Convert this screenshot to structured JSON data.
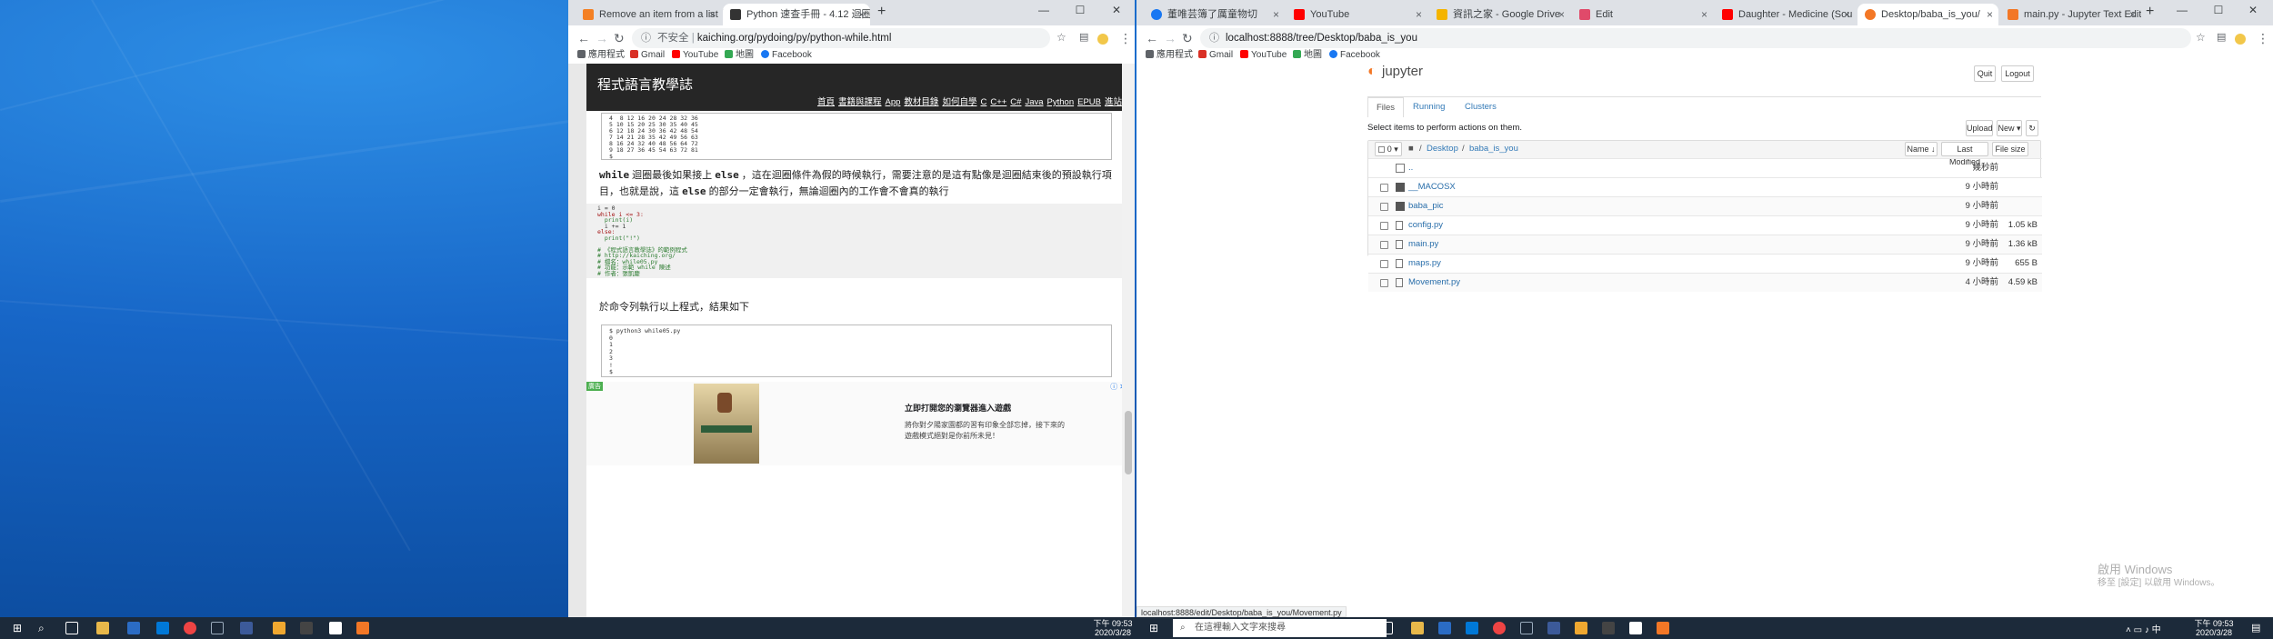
{
  "left_browser": {
    "tabs": [
      {
        "title": "Remove an item from a list in P",
        "close": "×"
      },
      {
        "title": "Python 速查手冊 - 4.12 迴圈敘述 w",
        "close": "×"
      }
    ],
    "new_tab": "+",
    "controls": {
      "min": "—",
      "max": "☐",
      "close": "✕"
    },
    "nav": {
      "back": "←",
      "forward": "→",
      "reload": "↻"
    },
    "address": {
      "security": "不安全",
      "url": "kaiching.org/pydoing/py/python-while.html"
    },
    "bookmarks": [
      "應用程式",
      "Gmail",
      "YouTube",
      "地圖",
      "Facebook"
    ],
    "site": {
      "title": "程式語言教學誌",
      "nav": [
        "首頁",
        "書籍與課程",
        "App",
        "教材目錄",
        "如何自學",
        "C",
        "C++",
        "C#",
        "Java",
        "Python",
        "EPUB",
        "進站"
      ]
    },
    "table_lines": [
      "4  8 12 16 20 24 28 32 36",
      "5 10 15 20 25 30 35 40 45",
      "6 12 18 24 30 36 42 48 54",
      "7 14 21 28 35 42 49 56 63",
      "8 16 24 32 40 48 56 64 72",
      "9 18 27 36 45 54 63 72 81",
      "$"
    ],
    "paragraph1": {
      "kw1": "while",
      "text1": " 迴圈最後如果接上 ",
      "kw2": "else",
      "text2": " ，這在迴圈條件為假的時候執行，需要注意的是這有點像是迴圈結束後的預設執行項目，也就是說，這 ",
      "kw3": "else",
      "text3": " 的部分一定會執行，無論迴圈內的工作會不會真的執行"
    },
    "code_lines": [
      {
        "t": "i = 0",
        "c": "#333"
      },
      {
        "t": "while i <= 3:",
        "c": "#a31515"
      },
      {
        "t": "  print(i)",
        "c": "#2e7d32"
      },
      {
        "t": "  i += 1",
        "c": "#333"
      },
      {
        "t": "else:",
        "c": "#a31515"
      },
      {
        "t": "  print(\"!\")",
        "c": "#2e7d32"
      },
      {
        "t": "",
        "c": "#333"
      },
      {
        "t": "# 《程式語言教學誌》的範例程式",
        "c": "#2e7d32"
      },
      {
        "t": "# http://kaiching.org/",
        "c": "#2e7d32"
      },
      {
        "t": "# 檔名：while05.py",
        "c": "#2e7d32"
      },
      {
        "t": "# 功能：示範 while 陳述",
        "c": "#2e7d32"
      },
      {
        "t": "# 作者：張凱慶",
        "c": "#2e7d32"
      }
    ],
    "paragraph2": "於命令列執行以上程式，結果如下",
    "output_lines": [
      "$ python3 while05.py",
      "0",
      "1",
      "2",
      "3",
      "!",
      "$"
    ],
    "ad": {
      "badge": "廣告",
      "headline": "立即打開您的瀏覽器進入遊戲",
      "body1": "將你對夕陽家園都的習有印象全部忘掉，接下來的",
      "body2": "遊戲模式絕對是你前所未見！",
      "close": "ⓘ ✕"
    }
  },
  "right_browser": {
    "tabs": [
      {
        "title": "董唯芸簿了厲童物切",
        "close": "×"
      },
      {
        "title": "YouTube",
        "close": "×"
      },
      {
        "title": "資訊之家 - Google Drive",
        "close": "×"
      },
      {
        "title": "Edit",
        "close": "×"
      },
      {
        "title": "Daughter - Medicine (Sou",
        "close": "×"
      },
      {
        "title": "Desktop/baba_is_you/",
        "close": "×"
      },
      {
        "title": "main.py - Jupyter Text Editor",
        "close": "×"
      }
    ],
    "new_tab": "+",
    "controls": {
      "min": "—",
      "max": "☐",
      "close": "✕"
    },
    "nav": {
      "back": "←",
      "forward": "→",
      "reload": "↻"
    },
    "address": {
      "url": "localhost:8888/tree/Desktop/baba_is_you"
    },
    "bookmarks": [
      "應用程式",
      "Gmail",
      "YouTube",
      "地圖",
      "Facebook"
    ],
    "status_url": "localhost:8888/edit/Desktop/baba_is_you/Movement.py",
    "jupyter": {
      "logo": "jupyter",
      "quit": "Quit",
      "logout": "Logout",
      "tabs": [
        "Files",
        "Running",
        "Clusters"
      ],
      "hint": "Select items to perform actions on them.",
      "upload": "Upload",
      "new": "New ▾",
      "refresh": "↻",
      "select_count": "0",
      "breadcrumb": [
        "Desktop",
        "baba_is_you"
      ],
      "sort_name": "Name ↓",
      "sort_modified": "Last Modified",
      "sort_size": "File size",
      "parent_row": {
        "name": "..",
        "time": "幾秒前"
      },
      "rows": [
        {
          "name": "__MACOSX",
          "kind": "folder",
          "time": "9 小時前",
          "size": ""
        },
        {
          "name": "baba_pic",
          "kind": "folder",
          "time": "9 小時前",
          "size": ""
        },
        {
          "name": "config.py",
          "kind": "file",
          "time": "9 小時前",
          "size": "1.05 kB"
        },
        {
          "name": "main.py",
          "kind": "file",
          "time": "9 小時前",
          "size": "1.36 kB"
        },
        {
          "name": "maps.py",
          "kind": "file",
          "time": "9 小時前",
          "size": "655 B"
        },
        {
          "name": "Movement.py",
          "kind": "file",
          "time": "4 小時前",
          "size": "4.59 kB"
        }
      ]
    }
  },
  "watermark": {
    "line1": "啟用 Windows",
    "line2": "移至 [設定] 以啟用 Windows。"
  },
  "taskbar_left": {
    "time": "下午 09:53",
    "date": "2020/3/28"
  },
  "taskbar_right": {
    "search": "在這裡輸入文字來搜尋",
    "time": "下午 09:53",
    "date": "2020/3/28"
  },
  "colors": {
    "accent": "#1a73e8",
    "link": "#296eaa",
    "taskbar": "#1c2a3a",
    "desktop": "#1766c7"
  }
}
